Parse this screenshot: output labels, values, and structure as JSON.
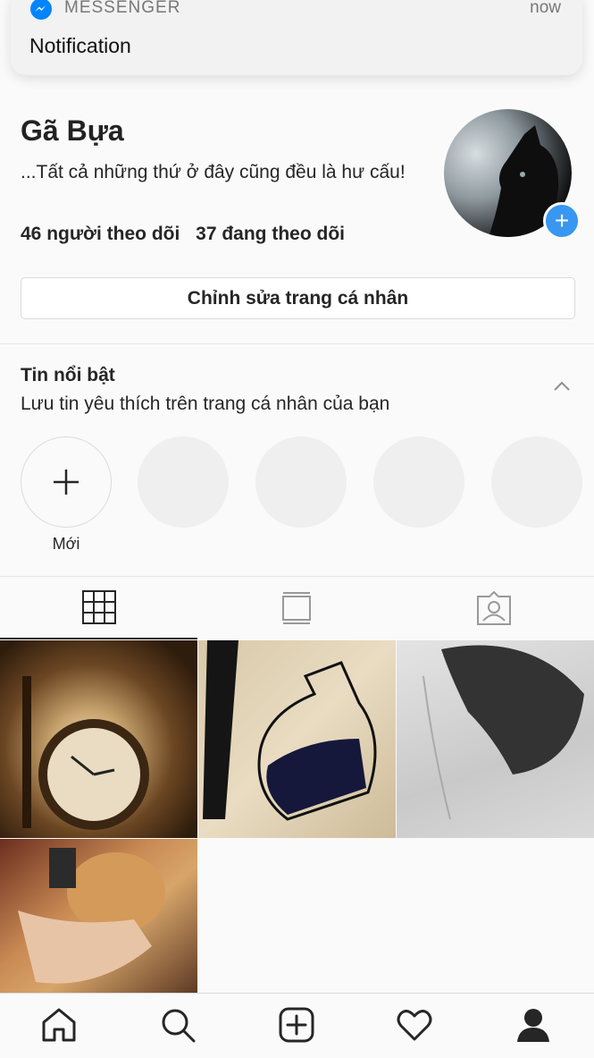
{
  "notification": {
    "app": "MESSENGER",
    "time": "now",
    "body": "Notification"
  },
  "profile": {
    "name": "Gã Bựa",
    "bio": "...Tất cả những thứ ở đây cũng đều là hư cấu!",
    "followers": "46 người theo dõi",
    "following": "37 đang theo dõi",
    "edit_button": "Chỉnh sửa trang cá nhân"
  },
  "highlights": {
    "title": "Tin nổi bật",
    "subtitle": "Lưu tin yêu thích trên trang cá nhân của bạn",
    "new_label": "Mới"
  },
  "tabs": [
    "grid-icon",
    "feed-icon",
    "tagged-icon"
  ],
  "tabbar": [
    "home-icon",
    "search-icon",
    "add-icon",
    "heart-icon",
    "profile-icon"
  ],
  "colors": {
    "accent": "#3897f0",
    "text": "#262626",
    "background": "#fafafa"
  }
}
